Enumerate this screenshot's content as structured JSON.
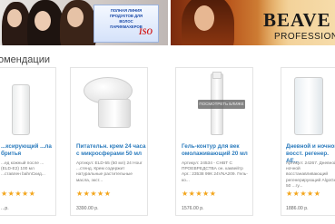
{
  "banners": {
    "left": {
      "package_lines": [
        "ПОЛНАЯ ЛИНИЯ",
        "ПРОДУКТОВ ДЛЯ",
        "ВОЛОС",
        "ПАРИКМАХЕРОВ"
      ],
      "logo": "ISO"
    },
    "right": {
      "brand": "BEAVE",
      "subtitle": "PROFESSIONAL"
    }
  },
  "section": {
    "title": "омендации"
  },
  "products": [
    {
      "name": "...ксирующий ...ла бритья",
      "desc": "...ед кожный после ...(ELD-E2) 100 мл ...ставлен bahnСкид...",
      "rating": "★★★★★",
      "price": "...р."
    },
    {
      "name": "Питательн. крем 24 часа с микросферами 50 мл",
      "desc": "Артикул: ELD-55 (50 мл) 24 Hour ...стенд. Крем содержит натуральные растительные масла, экст...",
      "rating": "★★★★★",
      "price": "3390.00 р."
    },
    {
      "name": "Гель-контур для век омолаживающий 20 мл",
      "desc": "Артикул: 24534 - CHBT C ПРОЕВРЕДСТВА он. каквейтр Apr.: 23538 99К 24VNA209. Гель-ко...",
      "rating": "★★★★★",
      "price": "1576.00 р.",
      "overlay_button": "ПОСМОТРЕТЬ БЛИЖЕ"
    },
    {
      "name": "Дневной и ночной восст. регенер. АЕ...",
      "desc": "Артикул: 24267. Дневной и ночной восстанавливающий регенерирующий AlgoGel 50 ...гу...",
      "rating": "★★★★★",
      "price": "1886.00 р."
    }
  ],
  "colors": {
    "link": "#2b7bbd",
    "star": "#f3a51b"
  }
}
